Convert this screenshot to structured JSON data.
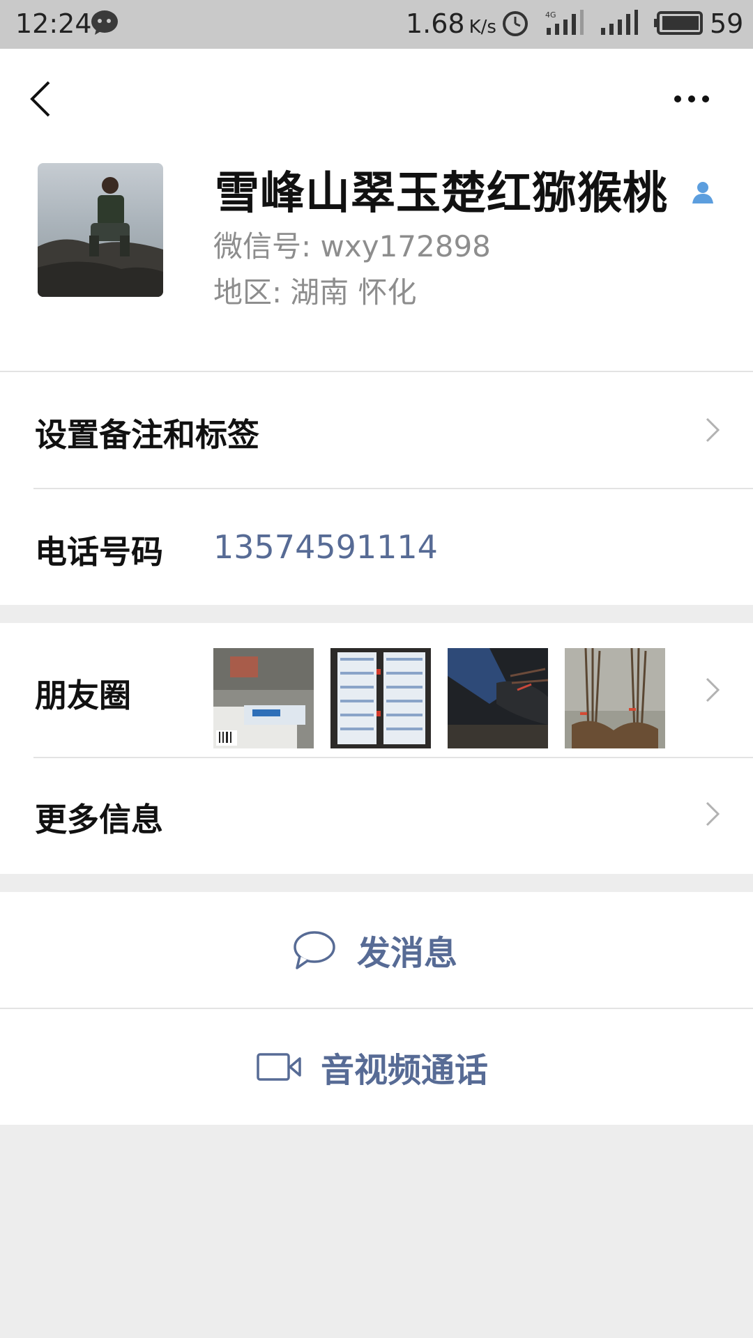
{
  "status_bar": {
    "time": "12:24",
    "speed": "1.68",
    "speed_unit": "K/s",
    "network": "4G",
    "battery": "59"
  },
  "colors": {
    "link": "#576b95",
    "background": "#ededed",
    "status_bar": "#c9c9c9"
  },
  "header": {
    "back_icon": "chevron-left-icon",
    "more_icon": "more-dots-icon"
  },
  "profile": {
    "name": "雪峰山翠玉楚红猕猴桃",
    "wechat_id": "微信号: wxy172898",
    "region_label": "地区:",
    "region_value": "湖南 怀化"
  },
  "rows": {
    "remark_label": "设置备注和标签",
    "phone_label": "电话号码",
    "phone_value": "13574591114",
    "moments_label": "朋友圈",
    "more_info_label": "更多信息"
  },
  "actions": {
    "message_label": "发消息",
    "message_icon": "chat-bubble-icon",
    "call_label": "音视频通话",
    "call_icon": "video-camera-icon"
  }
}
